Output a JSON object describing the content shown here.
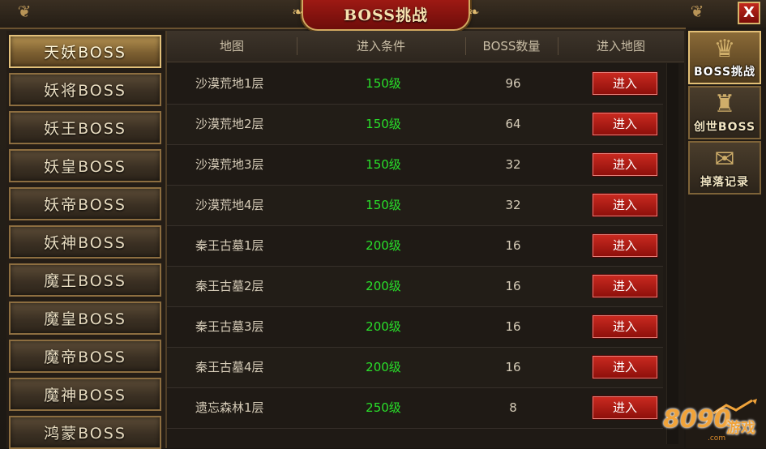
{
  "window": {
    "title": "BOSS挑战",
    "close_label": "X"
  },
  "boss_tabs": [
    {
      "label": "天妖BOSS",
      "active": true
    },
    {
      "label": "妖将BOSS",
      "active": false
    },
    {
      "label": "妖王BOSS",
      "active": false
    },
    {
      "label": "妖皇BOSS",
      "active": false
    },
    {
      "label": "妖帝BOSS",
      "active": false
    },
    {
      "label": "妖神BOSS",
      "active": false
    },
    {
      "label": "魔王BOSS",
      "active": false
    },
    {
      "label": "魔皇BOSS",
      "active": false
    },
    {
      "label": "魔帝BOSS",
      "active": false
    },
    {
      "label": "魔神BOSS",
      "active": false
    },
    {
      "label": "鸿蒙BOSS",
      "active": false
    }
  ],
  "table": {
    "headers": [
      "地图",
      "进入条件",
      "BOSS数量",
      "进入地图"
    ],
    "rows": [
      {
        "map": "沙漠荒地1层",
        "level": "150级",
        "count": "96",
        "action": "进入"
      },
      {
        "map": "沙漠荒地2层",
        "level": "150级",
        "count": "64",
        "action": "进入"
      },
      {
        "map": "沙漠荒地3层",
        "level": "150级",
        "count": "32",
        "action": "进入"
      },
      {
        "map": "沙漠荒地4层",
        "level": "150级",
        "count": "32",
        "action": "进入"
      },
      {
        "map": "秦王古墓1层",
        "level": "200级",
        "count": "16",
        "action": "进入"
      },
      {
        "map": "秦王古墓2层",
        "level": "200级",
        "count": "16",
        "action": "进入"
      },
      {
        "map": "秦王古墓3层",
        "level": "200级",
        "count": "16",
        "action": "进入"
      },
      {
        "map": "秦王古墓4层",
        "level": "200级",
        "count": "16",
        "action": "进入"
      },
      {
        "map": "遗忘森林1层",
        "level": "250级",
        "count": "8",
        "action": "进入"
      }
    ]
  },
  "categories": [
    {
      "label": "BOSS挑战",
      "icon": "demon-mask-icon",
      "active": true
    },
    {
      "label": "创世BOSS",
      "icon": "demon-helmet-icon",
      "active": false
    },
    {
      "label": "掉落记录",
      "icon": "scroll-icon",
      "active": false
    }
  ],
  "watermark": {
    "number": "8090",
    "text": "游戏",
    "domain": ".com"
  },
  "colors": {
    "level_green": "#29e02a",
    "button_red": "#c92a20",
    "gold_border": "#d2a860"
  }
}
